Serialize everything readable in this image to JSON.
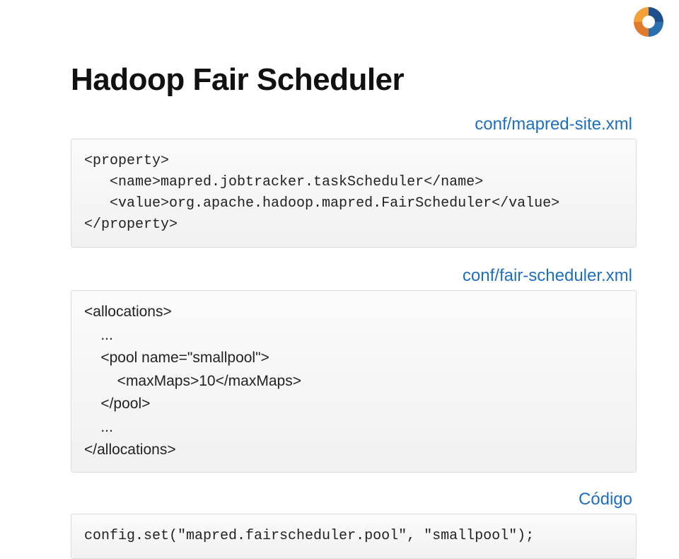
{
  "title": "Hadoop Fair Scheduler",
  "labels": {
    "mapredSite": "conf/mapred-site.xml",
    "fairScheduler": "conf/fair-scheduler.xml",
    "codigo": "Código"
  },
  "blocks": {
    "property": "<property>\n   <name>mapred.jobtracker.taskScheduler</name>\n   <value>org.apache.hadoop.mapred.FairScheduler</value>\n</property>",
    "allocations": "<allocations>\n    ...\n    <pool name=\"smallpool\">\n        <maxMaps>10</maxMaps>\n    </pool>\n    ...\n</allocations>",
    "config": "config.set(\"mapred.fairscheduler.pool\", \"smallpool\");"
  }
}
